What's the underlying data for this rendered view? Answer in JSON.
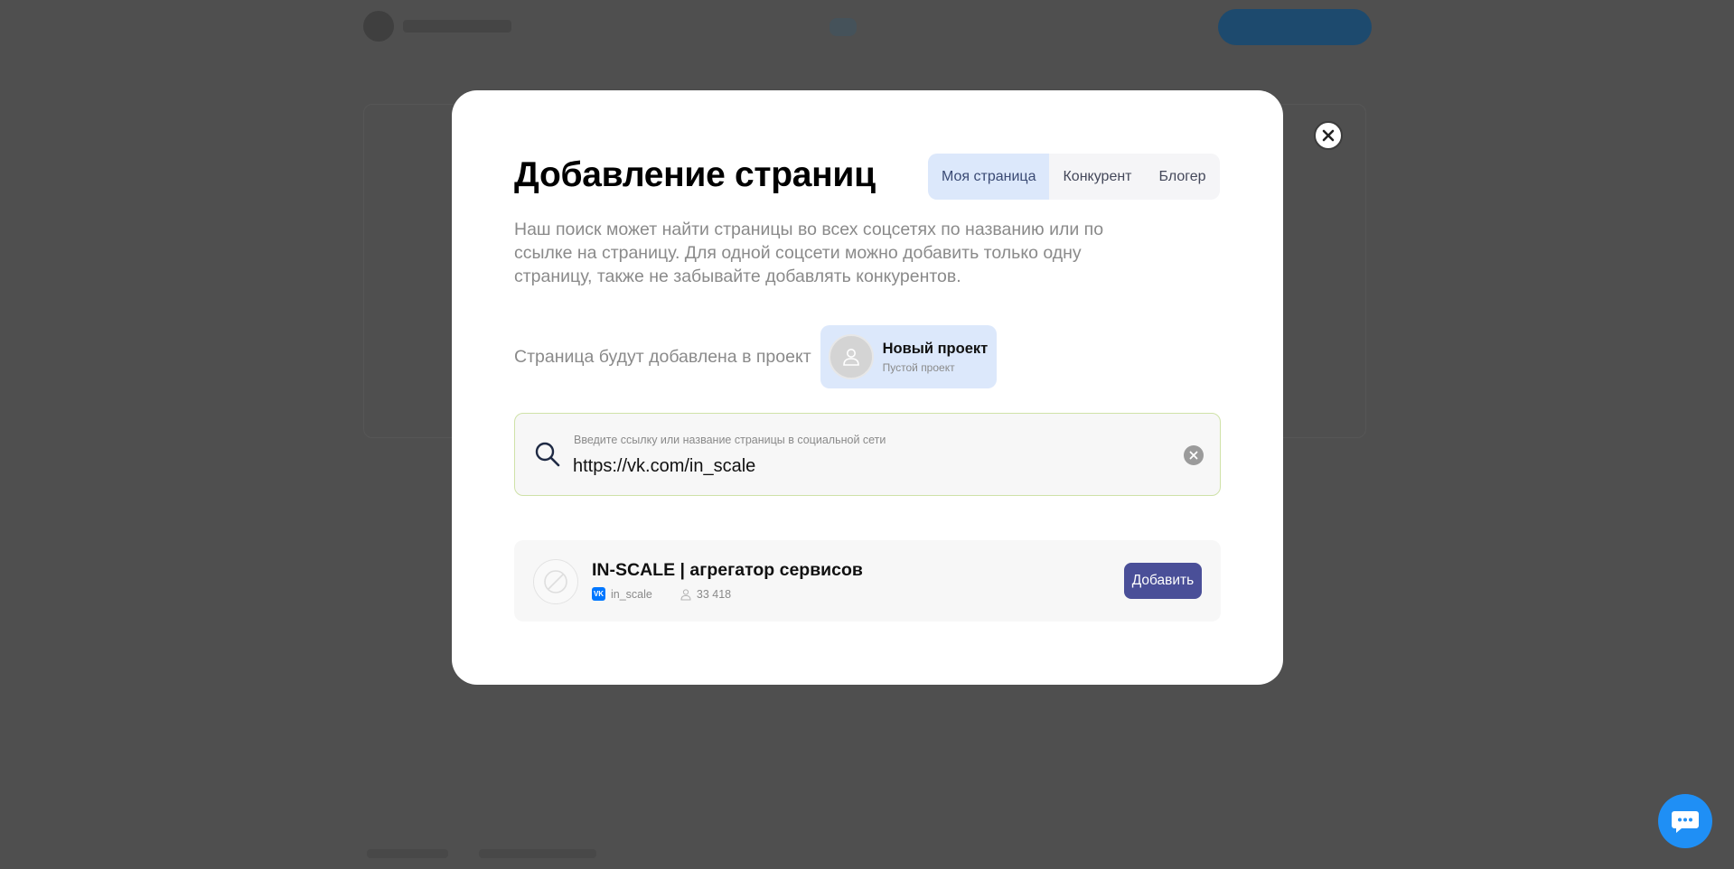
{
  "modal": {
    "title": "Добавление страниц",
    "tabs": [
      {
        "label": "Моя страница",
        "active": true
      },
      {
        "label": "Конкурент",
        "active": false
      },
      {
        "label": "Блогер",
        "active": false
      }
    ],
    "description": "Наш поиск может найти страницы во всех соцсетях по названию или по ссылке на страницу. Для одной соцсети можно добавить только одну страницу, также не забывайте добавлять конкурентов.",
    "project_label": "Страница будут добавлена в проект",
    "project": {
      "name": "Новый проект",
      "subtitle": "Пустой проект"
    },
    "search": {
      "label": "Введите ссылку или название страницы в социальной сети",
      "value": "https://vk.com/in_scale"
    },
    "result": {
      "title": "IN-SCALE | агрегатор сервисов",
      "network_badge": "VK",
      "handle": "in_scale",
      "members": "33 418",
      "add_label": "Добавить"
    }
  },
  "icons": {
    "close": "close-icon",
    "search": "search-icon",
    "clear": "clear-icon",
    "user": "user-icon",
    "no-image": "no-image-icon",
    "chat": "chat-icon"
  },
  "colors": {
    "overlay": "#4f4f4f",
    "tab_active": "#dce8fb",
    "add_button": "#4a4f98",
    "search_border": "#cfe2a8",
    "vk": "#0077ff",
    "chat_fab": "#1f8ff5"
  }
}
